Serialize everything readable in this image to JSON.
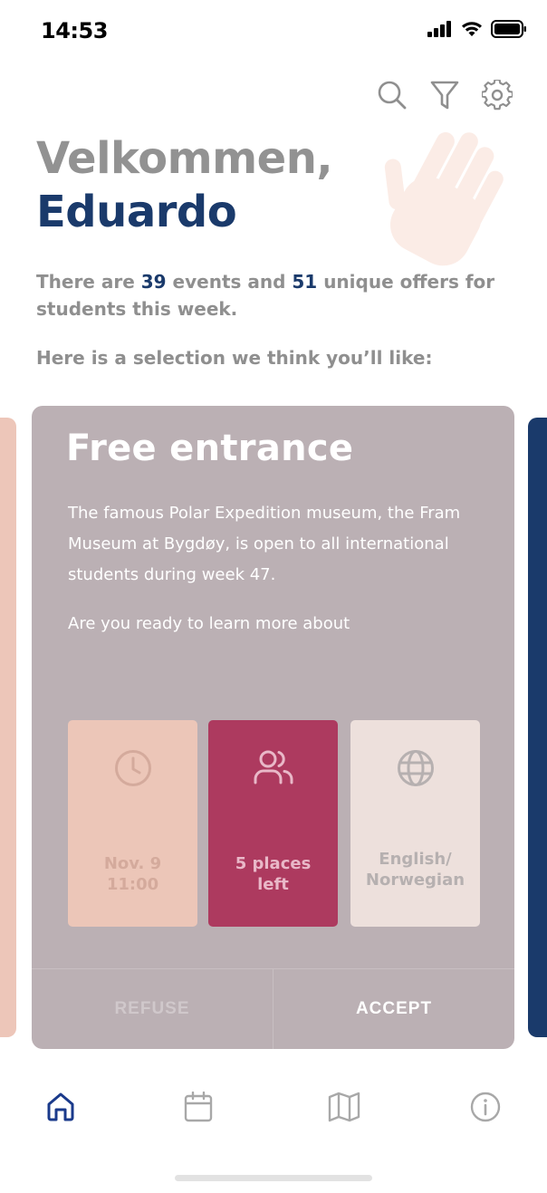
{
  "status_bar": {
    "time": "14:53",
    "icons": [
      "signal-icon",
      "wifi-icon",
      "battery-icon"
    ]
  },
  "header": {
    "actions": [
      "search-icon",
      "filter-icon",
      "settings-icon"
    ],
    "greeting": "Velkommen,",
    "user_name": "Eduardo",
    "decoration": "waving-hand-icon"
  },
  "summary": {
    "prefix": "There are ",
    "events_count": "39",
    "middle": " events and ",
    "offers_count": "51",
    "suffix": " unique offers for students this week.",
    "selection_text": "Here is a selection we think you’ll like:"
  },
  "card": {
    "title": "Free entrance",
    "description": "The famous Polar Expedition museum, the Fram Museum at Bygdøy, is open to all international students during week 47.",
    "question": "Are you ready to learn more about",
    "tiles": {
      "date": {
        "icon": "clock-icon",
        "line1": "Nov. 9",
        "line2": "11:00"
      },
      "places": {
        "icon": "people-icon",
        "line1": "5 places",
        "line2": "left"
      },
      "language": {
        "icon": "globe-icon",
        "line1": "English/",
        "line2": "Norwegian"
      }
    },
    "refuse_label": "REFUSE",
    "accept_label": "ACCEPT"
  },
  "bottom_nav": {
    "items": [
      {
        "icon": "home-icon",
        "active": true
      },
      {
        "icon": "calendar-icon",
        "active": false
      },
      {
        "icon": "map-icon",
        "active": false
      },
      {
        "icon": "info-icon",
        "active": false
      }
    ]
  },
  "colors": {
    "primary": "#1a3a6b",
    "card": "#bbb0b4",
    "accent": "#ad3a5f",
    "peach": "#ecc6b8",
    "muted_text": "#8f8f8f"
  }
}
